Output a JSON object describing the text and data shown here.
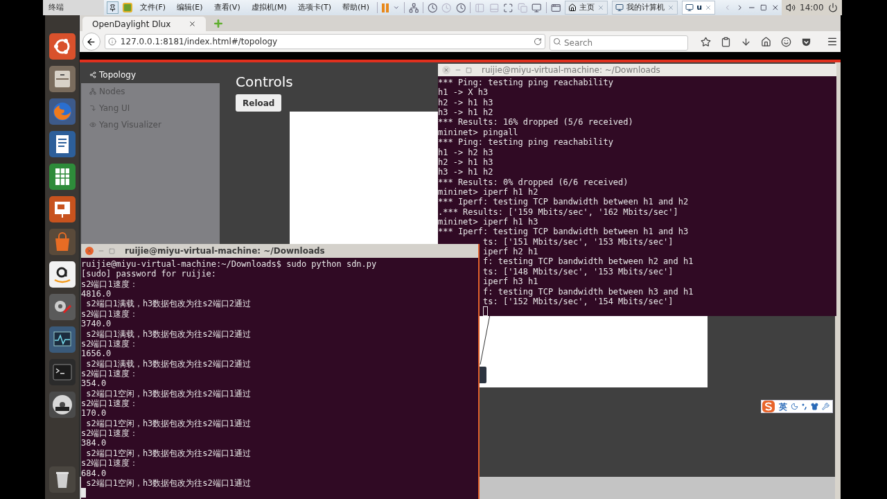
{
  "host_bar": {
    "title": "终端",
    "menus": [
      "文件(F)",
      "编辑(E)",
      "查看(V)",
      "虚拟机(M)",
      "选项卡(T)",
      "帮助(H)"
    ],
    "tabs": [
      {
        "label": "主页",
        "selected": false
      },
      {
        "label": "我的计算机",
        "selected": false
      },
      {
        "label": "u",
        "selected": true
      }
    ],
    "clock": "14:00"
  },
  "browser": {
    "tab_title": "OpenDaylight Dlux",
    "url": "127.0.0.1:8181/index.html#/topology",
    "search_placeholder": "Search"
  },
  "page": {
    "nav": [
      {
        "label": "Topology",
        "selected": true
      },
      {
        "label": "Nodes",
        "selected": false
      },
      {
        "label": "Yang UI",
        "selected": false
      },
      {
        "label": "Yang Visualizer",
        "selected": false
      }
    ],
    "heading": "Controls",
    "reload": "Reload"
  },
  "terminals": [
    {
      "title": "ruijie@miyu-virtual-machine: ~/Downloads",
      "active": false,
      "lines": [
        "*** Ping: testing ping reachability",
        "h1 -> X h3",
        "h2 -> h1 h3",
        "h3 -> h1 h2",
        "*** Results: 16% dropped (5/6 received)",
        "mininet> pingall",
        "*** Ping: testing ping reachability",
        "h1 -> h2 h3",
        "h2 -> h1 h3",
        "h3 -> h1 h2",
        "*** Results: 0% dropped (6/6 received)",
        "mininet> iperf h1 h2",
        "*** Iperf: testing TCP bandwidth between h1 and h2",
        ".*** Results: ['159 Mbits/sec', '162 Mbits/sec']",
        "mininet> iperf h1 h3",
        "*** Iperf: testing TCP bandwidth between h1 and h3"
      ],
      "cut_lines": [
        "ts: ['151 Mbits/sec', '153 Mbits/sec']",
        "iperf h2 h1",
        "f: testing TCP bandwidth between h2 and h1",
        "ts: ['148 Mbits/sec', '153 Mbits/sec']",
        "iperf h3 h1",
        "f: testing TCP bandwidth between h3 and h1",
        "ts: ['152 Mbits/sec', '154 Mbits/sec']"
      ]
    },
    {
      "title": "ruijie@miyu-virtual-machine: ~/Downloads",
      "active": true,
      "lines": [
        "ruijie@miyu-virtual-machine:~/Downloads$ sudo python sdn.py",
        "[sudo] password for ruijie:",
        "s2端口1速度：",
        "4816.0",
        " s2端口1满载，h3数据包改为往s2端口2通过",
        "s2端口1速度：",
        "3740.0",
        " s2端口1满载，h3数据包改为往s2端口2通过",
        "s2端口1速度：",
        "1656.0",
        " s2端口1满载，h3数据包改为往s2端口2通过",
        "s2端口1速度：",
        "354.0",
        " s2端口1空闲，h3数据包改为往s2端口1通过",
        "s2端口1速度：",
        "170.0",
        " s2端口1空闲，h3数据包改为往s2端口1通过",
        "s2端口1速度：",
        "384.0",
        " s2端口1空闲，h3数据包改为往s2端口1通过",
        "s2端口1速度：",
        "684.0",
        " s2端口1空闲，h3数据包改为往s2端口1通过"
      ]
    }
  ],
  "ime": {
    "mode": "英"
  }
}
